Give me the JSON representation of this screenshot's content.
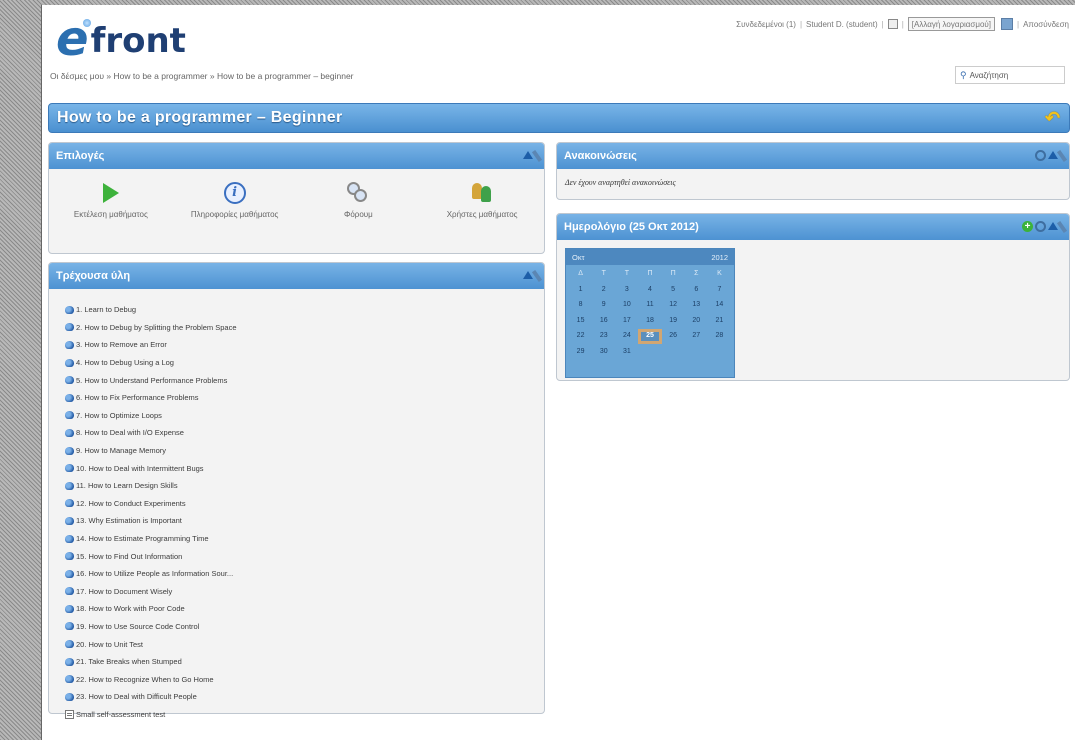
{
  "header": {
    "logo_e": "e",
    "logo_front": "front",
    "connected": "Συνδεδεμένοι (1)",
    "user": "Student D. (student)",
    "role_select": "[Αλλαγή λογαριασμού]",
    "logout": "Αποσύνδεση"
  },
  "breadcrumb": "Οι δέσμες μου » How to be a programmer » How to be a programmer – beginner",
  "search": {
    "placeholder": "Αναζήτηση"
  },
  "title": "How to be a programmer – Beginner",
  "options_panel": {
    "title": "Επιλογές",
    "items": [
      {
        "label": "Εκτέλεση μαθήματος",
        "icon": "play-icon"
      },
      {
        "label": "Πληροφορίες μαθήματος",
        "icon": "info-icon"
      },
      {
        "label": "Φόρουμ",
        "icon": "forum-icon"
      },
      {
        "label": "Χρήστες μαθήματος",
        "icon": "users-icon"
      }
    ]
  },
  "material_panel": {
    "title": "Τρέχουσα ύλη",
    "units": [
      "1. Learn to Debug",
      "2. How to Debug by Splitting the Problem Space",
      "3. How to Remove an Error",
      "4. How to Debug Using a Log",
      "5. How to Understand Performance Problems",
      "6. How to Fix Performance Problems",
      "7. How to Optimize Loops",
      "8. How to Deal with I/O Expense",
      "9. How to Manage Memory",
      "10. How to Deal with Intermittent Bugs",
      "11. How to Learn Design Skills",
      "12. How to Conduct Experiments",
      "13. Why Estimation is Important",
      "14. How to Estimate Programming Time",
      "15. How to Find Out Information",
      "16. How to Utilize People as Information Sour...",
      "17. How to Document Wisely",
      "18. How to Work with Poor Code",
      "19. How to Use Source Code Control",
      "20. How to Unit Test",
      "21. Take Breaks when Stumped",
      "22. How to Recognize When to Go Home",
      "23. How to Deal with Difficult People"
    ],
    "test": "Small self-assessment test"
  },
  "announcements_panel": {
    "title": "Ανακοινώσεις",
    "empty": "Δεν έχουν αναρτηθεί ανακοινώσεις"
  },
  "calendar_panel": {
    "title": "Ημερολόγιο (25 Οκτ 2012)",
    "month": "Οκτ",
    "year": "2012",
    "day_names": [
      "Δ",
      "Τ",
      "Τ",
      "Π",
      "Π",
      "Σ",
      "Κ"
    ],
    "days": [
      "1",
      "2",
      "3",
      "4",
      "5",
      "6",
      "7",
      "8",
      "9",
      "10",
      "11",
      "12",
      "13",
      "14",
      "15",
      "16",
      "17",
      "18",
      "19",
      "20",
      "21",
      "22",
      "23",
      "24",
      "25",
      "26",
      "27",
      "28",
      "29",
      "30",
      "31"
    ],
    "today": "25"
  },
  "colors": {
    "accent": "#4d92d2",
    "logo_blue": "#2b6fb0",
    "calendar_bg": "#6aa6d6",
    "today_outline": "#d1a672"
  }
}
